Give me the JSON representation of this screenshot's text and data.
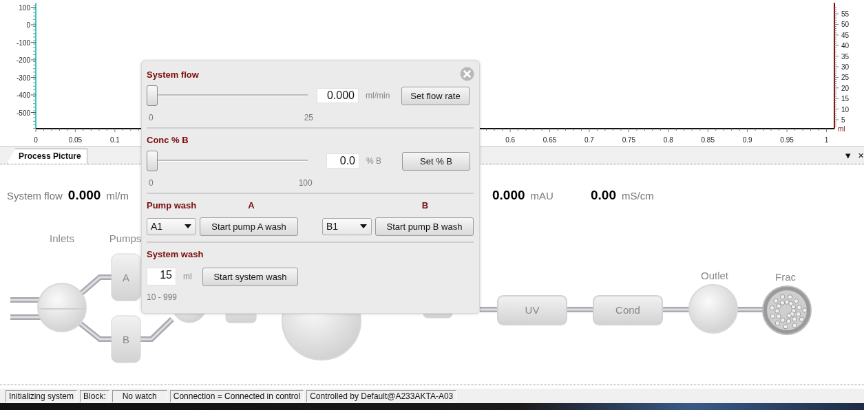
{
  "chart_panel": {
    "chart_data": {
      "type": "line",
      "xlim": [
        0,
        1.01
      ],
      "ylim": [
        -590,
        125
      ],
      "xticks": [
        0,
        0.05,
        0.1,
        0.6,
        0.65,
        0.7,
        0.75,
        0.8,
        0.85,
        0.9,
        0.95,
        1
      ],
      "yticks": [
        100,
        0,
        -100,
        -200,
        -300,
        -400,
        -500
      ]
    },
    "right_axis": {
      "ticks": [
        "55",
        "50",
        "45",
        "40",
        "35",
        "30",
        "25",
        "20",
        "15",
        "10",
        "5"
      ],
      "unit": "ml"
    }
  },
  "tabs": [
    {
      "label": "Process Picture",
      "selected": true
    }
  ],
  "tab_menu": "▾",
  "tab_close": "×",
  "readings": [
    {
      "label": "System flow",
      "value": "0.000",
      "unit": "ml/m"
    },
    {
      "value": "0.000",
      "unit": "mAU"
    },
    {
      "value": "0.00",
      "unit": "mS/cm"
    }
  ],
  "diagram": {
    "section_labels": [
      "Inlets",
      "Pumps"
    ],
    "pumps": [
      "A",
      "B"
    ],
    "components": [
      {
        "kind": "box",
        "label": "UV"
      },
      {
        "kind": "box",
        "label": "Cond"
      },
      {
        "kind": "ball",
        "label": "Outlet"
      },
      {
        "kind": "coil",
        "label": "Frac"
      }
    ]
  },
  "dialog": {
    "sections": [
      {
        "kind": "slider",
        "title": "System flow",
        "level": 0,
        "value": "0.000",
        "unit": "ml/min",
        "button": "Set flow rate",
        "min": "0",
        "max": "25"
      },
      {
        "kind": "slider",
        "title": "Conc % B",
        "level": 0,
        "value": "0.0",
        "unit": "% B",
        "button": "Set % B",
        "min": "0",
        "max": "100"
      },
      {
        "kind": "pump_wash",
        "title": "Pump wash",
        "pumps": [
          {
            "label": "A",
            "inlet": "A1",
            "button": "Start pump A wash"
          },
          {
            "label": "B",
            "inlet": "B1",
            "button": "Start pump B wash"
          }
        ]
      },
      {
        "kind": "system_wash",
        "title": "System wash",
        "value": "15",
        "unit": "ml",
        "button": "Start system wash",
        "range": "10 - 999"
      }
    ]
  },
  "status_bar": [
    "Initializing system",
    "Block:",
    "No watch",
    "Connection = Connected in control",
    "Controlled by Default@A233AKTA-A03"
  ]
}
